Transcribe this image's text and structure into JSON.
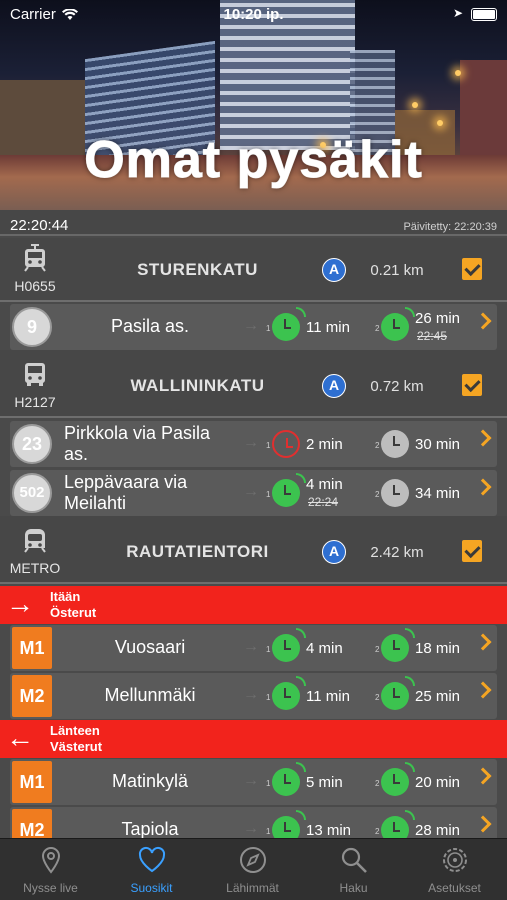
{
  "status": {
    "carrier": "Carrier",
    "time": "10:20 ip."
  },
  "header": {
    "title": "Omat pysäkit"
  },
  "timebar": {
    "now": "22:20:44",
    "updated": "Päivitetty: 22:20:39"
  },
  "stops": [
    {
      "code": "H0655",
      "name": "STURENKATU",
      "zone": "A",
      "distance": "0.21 km",
      "vehicle": "tram-icon",
      "rows": [
        {
          "line": "9",
          "destination": "Pasila as.",
          "dep1": {
            "time": "11 min",
            "status": "realtime"
          },
          "dep2": {
            "time": "26 min",
            "scheduled": "22:45",
            "status": "realtime"
          }
        }
      ]
    },
    {
      "code": "H2127",
      "name": "WALLININKATU",
      "zone": "A",
      "distance": "0.72 km",
      "vehicle": "bus-icon",
      "rows": [
        {
          "line": "23",
          "destination": "Pirkkola via Pasila as.",
          "dep1": {
            "time": "2 min",
            "status": "late"
          },
          "dep2": {
            "time": "30 min",
            "status": "scheduled"
          }
        },
        {
          "line": "502",
          "destination": "Leppävaara via Meilahti",
          "dep1": {
            "time": "4 min",
            "scheduled": "22:24",
            "status": "realtime"
          },
          "dep2": {
            "time": "34 min",
            "status": "scheduled"
          }
        }
      ]
    },
    {
      "code": "METRO",
      "name": "RAUTATIENTORI",
      "zone": "A",
      "distance": "2.42 km",
      "vehicle": "metro-icon",
      "directions": [
        {
          "arrow": "→",
          "fi": "Itään",
          "sv": "Österut",
          "rows": [
            {
              "line": "M1",
              "destination": "Vuosaari",
              "dep1": {
                "time": "4 min"
              },
              "dep2": {
                "time": "18 min"
              }
            },
            {
              "line": "M2",
              "destination": "Mellunmäki",
              "dep1": {
                "time": "11 min"
              },
              "dep2": {
                "time": "25 min"
              }
            }
          ]
        },
        {
          "arrow": "←",
          "fi": "Länteen",
          "sv": "Västerut",
          "rows": [
            {
              "line": "M1",
              "destination": "Matinkylä",
              "dep1": {
                "time": "5 min"
              },
              "dep2": {
                "time": "20 min"
              }
            },
            {
              "line": "M2",
              "destination": "Tapiola",
              "dep1": {
                "time": "13 min"
              },
              "dep2": {
                "time": "28 min"
              }
            }
          ]
        }
      ]
    }
  ],
  "dep_index": {
    "first": "1",
    "second": "2"
  },
  "tabs": [
    {
      "label": "Nysse live",
      "icon": "map-pin-icon",
      "active": false
    },
    {
      "label": "Suosikit",
      "icon": "heart-icon",
      "active": true
    },
    {
      "label": "Lähimmät",
      "icon": "compass-icon",
      "active": false
    },
    {
      "label": "Haku",
      "icon": "search-icon",
      "active": false
    },
    {
      "label": "Asetukset",
      "icon": "gear-icon",
      "active": false
    }
  ],
  "colors": {
    "accent": "#f5a523",
    "realtime": "#3cc34f",
    "late": "#e12f2f",
    "direction": "#f2231c",
    "metro": "#f07c1f",
    "active_tab": "#3aa0ff",
    "zone": "#2e6fd1"
  }
}
